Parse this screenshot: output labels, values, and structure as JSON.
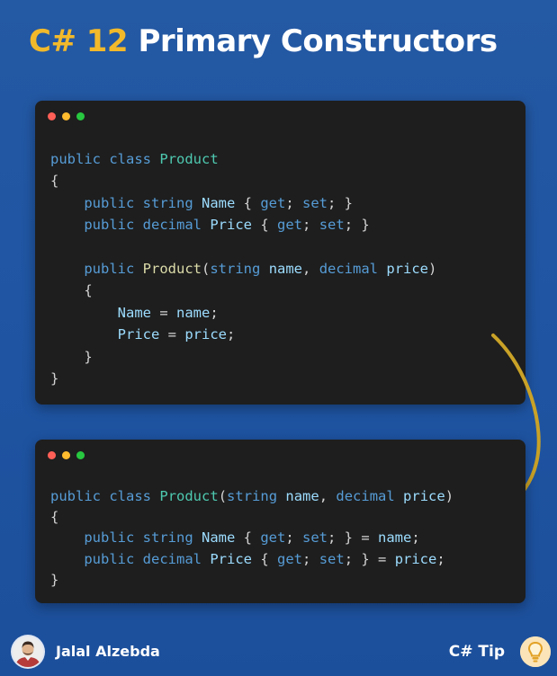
{
  "title": {
    "accent": "C# 12",
    "rest": "Primary Constructors"
  },
  "code_before": [
    [
      [
        "kw",
        "public"
      ],
      [
        "punc",
        " "
      ],
      [
        "kw",
        "class"
      ],
      [
        "punc",
        " "
      ],
      [
        "type",
        "Product"
      ]
    ],
    [
      [
        "punc",
        "{"
      ]
    ],
    [
      [
        "punc",
        "    "
      ],
      [
        "kw",
        "public"
      ],
      [
        "punc",
        " "
      ],
      [
        "kw",
        "string"
      ],
      [
        "punc",
        " "
      ],
      [
        "prop",
        "Name"
      ],
      [
        "punc",
        " { "
      ],
      [
        "kw",
        "get"
      ],
      [
        "punc",
        "; "
      ],
      [
        "kw",
        "set"
      ],
      [
        "punc",
        "; }"
      ]
    ],
    [
      [
        "punc",
        "    "
      ],
      [
        "kw",
        "public"
      ],
      [
        "punc",
        " "
      ],
      [
        "kw",
        "decimal"
      ],
      [
        "punc",
        " "
      ],
      [
        "prop",
        "Price"
      ],
      [
        "punc",
        " { "
      ],
      [
        "kw",
        "get"
      ],
      [
        "punc",
        "; "
      ],
      [
        "kw",
        "set"
      ],
      [
        "punc",
        "; }"
      ]
    ],
    [],
    [
      [
        "punc",
        "    "
      ],
      [
        "kw",
        "public"
      ],
      [
        "punc",
        " "
      ],
      [
        "method",
        "Product"
      ],
      [
        "punc",
        "("
      ],
      [
        "kw",
        "string"
      ],
      [
        "punc",
        " "
      ],
      [
        "prop",
        "name"
      ],
      [
        "punc",
        ", "
      ],
      [
        "kw",
        "decimal"
      ],
      [
        "punc",
        " "
      ],
      [
        "prop",
        "price"
      ],
      [
        "punc",
        ")"
      ]
    ],
    [
      [
        "punc",
        "    {"
      ]
    ],
    [
      [
        "punc",
        "        "
      ],
      [
        "prop",
        "Name"
      ],
      [
        "punc",
        " = "
      ],
      [
        "prop",
        "name"
      ],
      [
        "punc",
        ";"
      ]
    ],
    [
      [
        "punc",
        "        "
      ],
      [
        "prop",
        "Price"
      ],
      [
        "punc",
        " = "
      ],
      [
        "prop",
        "price"
      ],
      [
        "punc",
        ";"
      ]
    ],
    [
      [
        "punc",
        "    }"
      ]
    ],
    [
      [
        "punc",
        "}"
      ]
    ]
  ],
  "code_after": [
    [
      [
        "kw",
        "public"
      ],
      [
        "punc",
        " "
      ],
      [
        "kw",
        "class"
      ],
      [
        "punc",
        " "
      ],
      [
        "type",
        "Product"
      ],
      [
        "punc",
        "("
      ],
      [
        "kw",
        "string"
      ],
      [
        "punc",
        " "
      ],
      [
        "prop",
        "name"
      ],
      [
        "punc",
        ", "
      ],
      [
        "kw",
        "decimal"
      ],
      [
        "punc",
        " "
      ],
      [
        "prop",
        "price"
      ],
      [
        "punc",
        ")"
      ]
    ],
    [
      [
        "punc",
        "{"
      ]
    ],
    [
      [
        "punc",
        "    "
      ],
      [
        "kw",
        "public"
      ],
      [
        "punc",
        " "
      ],
      [
        "kw",
        "string"
      ],
      [
        "punc",
        " "
      ],
      [
        "prop",
        "Name"
      ],
      [
        "punc",
        " { "
      ],
      [
        "kw",
        "get"
      ],
      [
        "punc",
        "; "
      ],
      [
        "kw",
        "set"
      ],
      [
        "punc",
        "; } = "
      ],
      [
        "prop",
        "name"
      ],
      [
        "punc",
        ";"
      ]
    ],
    [
      [
        "punc",
        "    "
      ],
      [
        "kw",
        "public"
      ],
      [
        "punc",
        " "
      ],
      [
        "kw",
        "decimal"
      ],
      [
        "punc",
        " "
      ],
      [
        "prop",
        "Price"
      ],
      [
        "punc",
        " { "
      ],
      [
        "kw",
        "get"
      ],
      [
        "punc",
        "; "
      ],
      [
        "kw",
        "set"
      ],
      [
        "punc",
        "; } = "
      ],
      [
        "prop",
        "price"
      ],
      [
        "punc",
        ";"
      ]
    ],
    [
      [
        "punc",
        "}"
      ]
    ]
  ],
  "footer": {
    "author": "Jalal Alzebda",
    "tip": "C# Tip"
  },
  "icons": {
    "window_controls": [
      "close-dot",
      "minimize-dot",
      "maximize-dot"
    ],
    "arrow": "curved-arrow-icon",
    "avatar": "avatar",
    "tip": "lightbulb-icon"
  },
  "colors": {
    "background": "#2057a3",
    "accent": "#f2b92b",
    "code_bg": "#1e1e1e",
    "keyword": "#569cd6",
    "type": "#4ec9b0",
    "identifier": "#9cdcfe",
    "method": "#dcdcaa",
    "arrow": "#c9a227"
  }
}
